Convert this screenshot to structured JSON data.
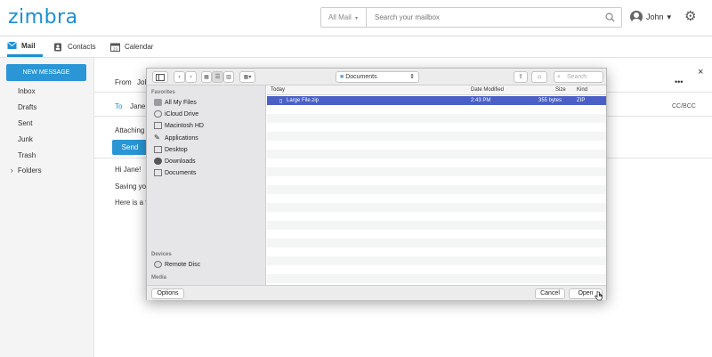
{
  "app": {
    "logo": "zimbra"
  },
  "search": {
    "scope": "All Mail",
    "placeholder": "Search your mailbox"
  },
  "user": {
    "name": "John"
  },
  "nav": {
    "mail": "Mail",
    "contacts": "Contacts",
    "calendar": "Calendar"
  },
  "sidebar": {
    "new_message": "NEW MESSAGE",
    "items": [
      "Inbox",
      "Drafts",
      "Sent",
      "Junk",
      "Trash",
      "Folders"
    ]
  },
  "compose": {
    "from_label": "From",
    "from_value": "Jol",
    "to_label": "To",
    "to_value": "Jane",
    "cc_bcc": "CC/BCC",
    "attaching": "Attaching f",
    "send": "Send",
    "body": [
      "Hi Jane!",
      "Saving you",
      "Here is a fi"
    ],
    "more": "•••",
    "close": "×"
  },
  "dialog": {
    "location": "Documents",
    "search_placeholder": "Search",
    "sidebar": {
      "favorites_label": "Favorites",
      "favorites": [
        "All My Files",
        "iCloud Drive",
        "Macintosh HD",
        "Applications",
        "Desktop",
        "Downloads",
        "Documents"
      ],
      "devices_label": "Devices",
      "devices": [
        "Remote Disc"
      ],
      "media_label": "Media"
    },
    "columns": {
      "name": "Today",
      "date": "Date Modified",
      "size": "Size",
      "kind": "Kind"
    },
    "files": [
      {
        "name": "Large File.zip",
        "date": "2:43 PM",
        "size": "355 bytes",
        "kind": "ZIP",
        "selected": true
      }
    ],
    "options": "Options",
    "cancel": "Cancel",
    "open": "Open"
  },
  "colors": {
    "accent": "#1a8fd4",
    "selection": "#4a60c6"
  }
}
